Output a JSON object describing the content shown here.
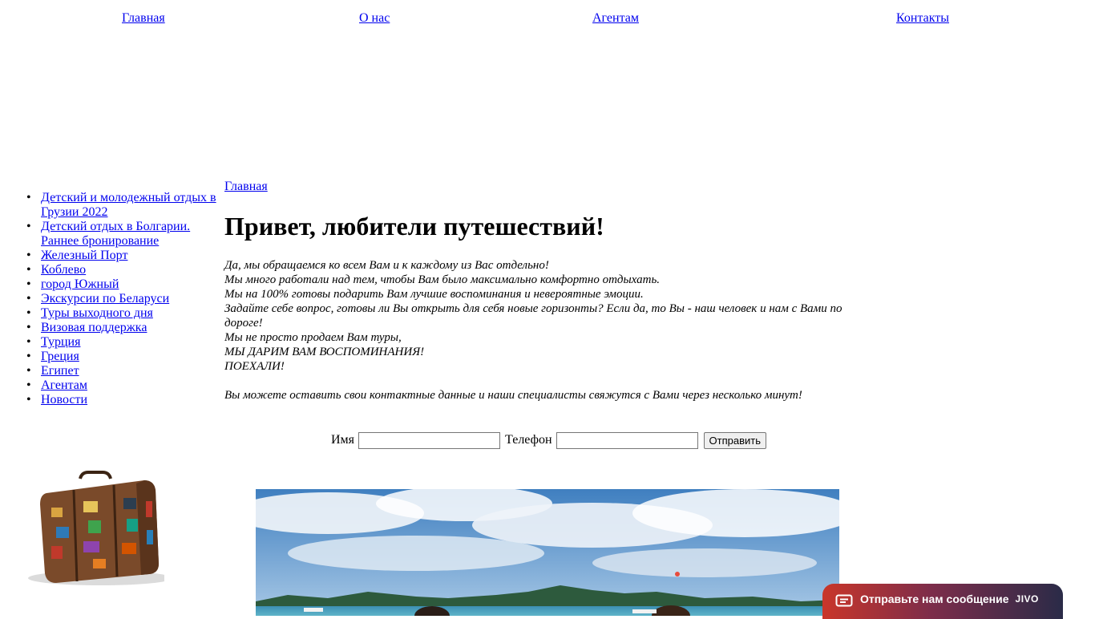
{
  "top_nav": [
    {
      "label": "Главная"
    },
    {
      "label": "О нас"
    },
    {
      "label": "Агентам"
    },
    {
      "label": "Контакты"
    }
  ],
  "sidebar": {
    "items": [
      {
        "label": "Детский и молодежный отдых в Грузии 2022"
      },
      {
        "label": "Детский отдых в Болгарии. Раннее бронирование"
      },
      {
        "label": "Железный Порт"
      },
      {
        "label": "Коблево"
      },
      {
        "label": "город Южный"
      },
      {
        "label": "Экскурсии по Беларуси"
      },
      {
        "label": "Туры выходного дня"
      },
      {
        "label": "Визовая поддержка"
      },
      {
        "label": "Турция"
      },
      {
        "label": "Греция"
      },
      {
        "label": "Египет"
      },
      {
        "label": "Агентам"
      },
      {
        "label": "Новости"
      }
    ]
  },
  "breadcrumb": {
    "label": "Главная"
  },
  "main": {
    "title": "Привет, любители путешествий!",
    "intro_lines": [
      "Да, мы обращаемся ко всем Вам и к каждому из Вас отдельно!",
      "Мы много работали над тем, чтобы Вам было максимально комфортно отдыхать.",
      "Мы на 100% готовы подарить Вам лучшие воспоминания и невероятные эмоции.",
      "Задайте себе вопрос, готовы ли Вы открыть для себя новые горизонты? Если да, то Вы - наш человек и нам с Вами по дороге!",
      "Мы не просто продаем Вам туры,",
      "МЫ ДАРИМ ВАМ ВОСПОМИНАНИЯ!",
      "ПОЕХАЛИ!",
      "",
      "Вы можете оставить свои контактные данные и наши специалисты свяжутся с Вами через несколько минут!"
    ]
  },
  "form": {
    "name_label": "Имя",
    "name_value": "",
    "phone_label": "Телефон",
    "phone_value": "",
    "submit_label": "Отправить"
  },
  "chat_widget": {
    "label": "Отправьте нам сообщение",
    "brand": "JIVO",
    "icon": "message-icon"
  },
  "colors": {
    "link": "#0000ee",
    "chat_gradient_start": "#c9362a",
    "chat_gradient_end": "#2a2b48"
  }
}
